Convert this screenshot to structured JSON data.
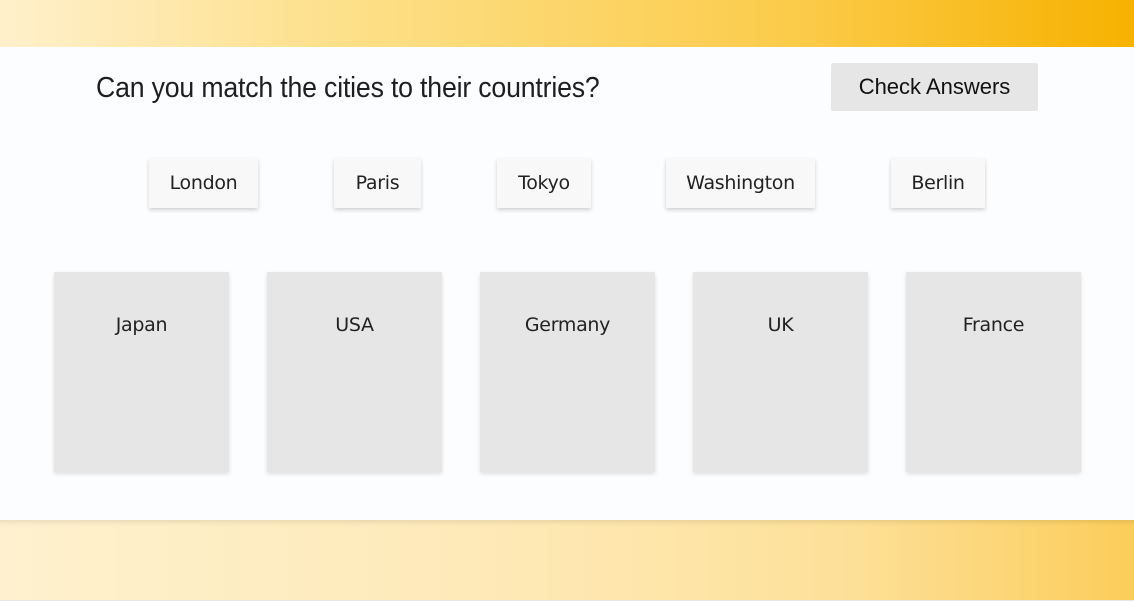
{
  "quiz": {
    "title": "Can you match the cities to their countries?",
    "check_button_label": "Check Answers",
    "cities": [
      "London",
      "Paris",
      "Tokyo",
      "Washington",
      "Berlin"
    ],
    "countries": [
      "Japan",
      "USA",
      "Germany",
      "UK",
      "France"
    ]
  },
  "colors": {
    "accent": "#f7b200",
    "accent_light": "#fff0cc",
    "tile_background": "#e6e6e6",
    "card_background": "#f8f8f8"
  }
}
